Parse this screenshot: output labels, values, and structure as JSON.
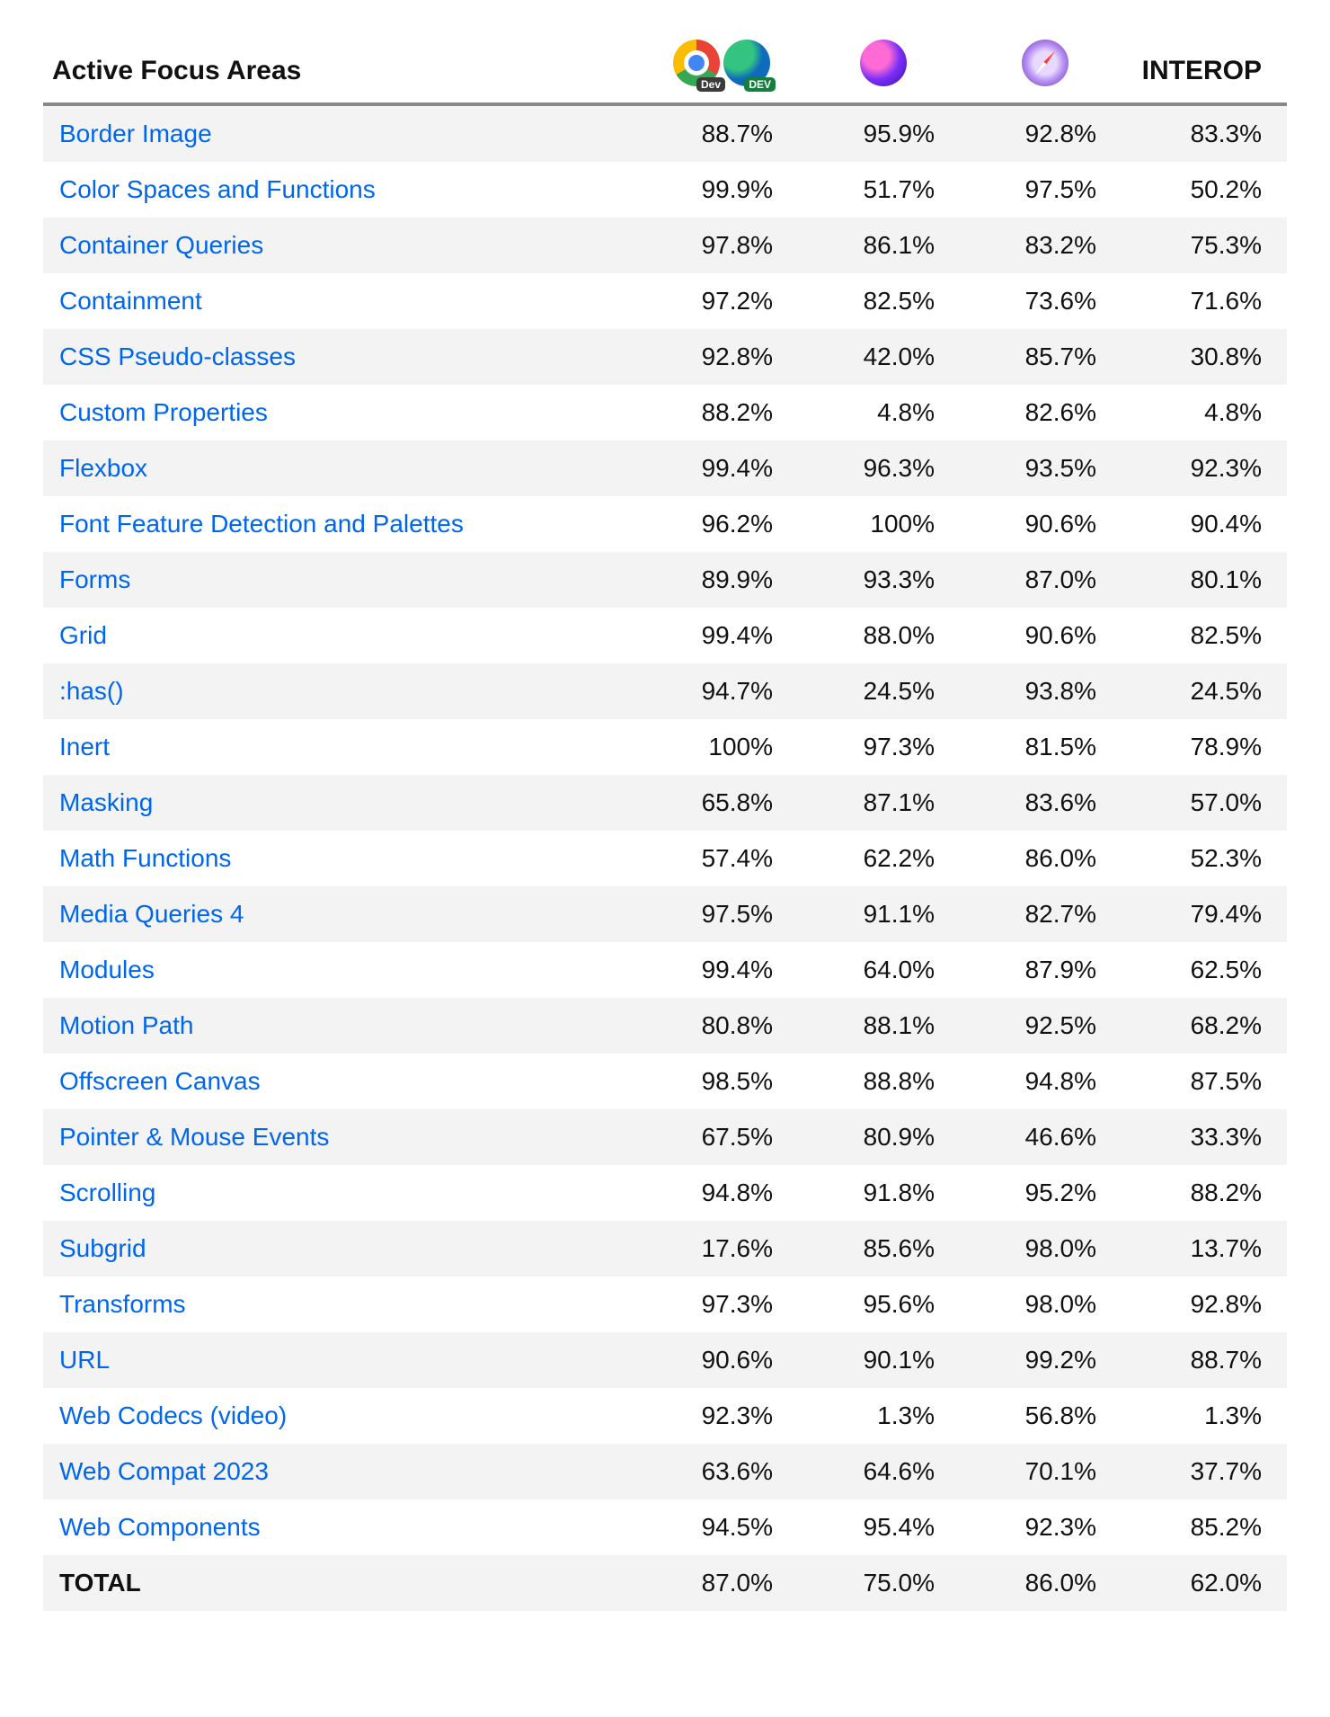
{
  "table": {
    "header": {
      "title": "Active Focus Areas",
      "interop_label": "INTEROP"
    },
    "browsers": {
      "chrome_badge": "Dev",
      "edge_badge": "DEV"
    },
    "rows": [
      {
        "name": "Border Image",
        "chrome_edge": "88.7%",
        "firefox": "95.9%",
        "safari": "92.8%",
        "interop": "83.3%"
      },
      {
        "name": "Color Spaces and Functions",
        "chrome_edge": "99.9%",
        "firefox": "51.7%",
        "safari": "97.5%",
        "interop": "50.2%"
      },
      {
        "name": "Container Queries",
        "chrome_edge": "97.8%",
        "firefox": "86.1%",
        "safari": "83.2%",
        "interop": "75.3%"
      },
      {
        "name": "Containment",
        "chrome_edge": "97.2%",
        "firefox": "82.5%",
        "safari": "73.6%",
        "interop": "71.6%"
      },
      {
        "name": "CSS Pseudo-classes",
        "chrome_edge": "92.8%",
        "firefox": "42.0%",
        "safari": "85.7%",
        "interop": "30.8%"
      },
      {
        "name": "Custom Properties",
        "chrome_edge": "88.2%",
        "firefox": "4.8%",
        "safari": "82.6%",
        "interop": "4.8%"
      },
      {
        "name": "Flexbox",
        "chrome_edge": "99.4%",
        "firefox": "96.3%",
        "safari": "93.5%",
        "interop": "92.3%"
      },
      {
        "name": "Font Feature Detection and Palettes",
        "chrome_edge": "96.2%",
        "firefox": "100%",
        "safari": "90.6%",
        "interop": "90.4%"
      },
      {
        "name": "Forms",
        "chrome_edge": "89.9%",
        "firefox": "93.3%",
        "safari": "87.0%",
        "interop": "80.1%"
      },
      {
        "name": "Grid",
        "chrome_edge": "99.4%",
        "firefox": "88.0%",
        "safari": "90.6%",
        "interop": "82.5%"
      },
      {
        "name": ":has()",
        "chrome_edge": "94.7%",
        "firefox": "24.5%",
        "safari": "93.8%",
        "interop": "24.5%"
      },
      {
        "name": "Inert",
        "chrome_edge": "100%",
        "firefox": "97.3%",
        "safari": "81.5%",
        "interop": "78.9%"
      },
      {
        "name": "Masking",
        "chrome_edge": "65.8%",
        "firefox": "87.1%",
        "safari": "83.6%",
        "interop": "57.0%"
      },
      {
        "name": "Math Functions",
        "chrome_edge": "57.4%",
        "firefox": "62.2%",
        "safari": "86.0%",
        "interop": "52.3%"
      },
      {
        "name": "Media Queries 4",
        "chrome_edge": "97.5%",
        "firefox": "91.1%",
        "safari": "82.7%",
        "interop": "79.4%"
      },
      {
        "name": "Modules",
        "chrome_edge": "99.4%",
        "firefox": "64.0%",
        "safari": "87.9%",
        "interop": "62.5%"
      },
      {
        "name": "Motion Path",
        "chrome_edge": "80.8%",
        "firefox": "88.1%",
        "safari": "92.5%",
        "interop": "68.2%"
      },
      {
        "name": "Offscreen Canvas",
        "chrome_edge": "98.5%",
        "firefox": "88.8%",
        "safari": "94.8%",
        "interop": "87.5%"
      },
      {
        "name": "Pointer & Mouse Events",
        "chrome_edge": "67.5%",
        "firefox": "80.9%",
        "safari": "46.6%",
        "interop": "33.3%"
      },
      {
        "name": "Scrolling",
        "chrome_edge": "94.8%",
        "firefox": "91.8%",
        "safari": "95.2%",
        "interop": "88.2%"
      },
      {
        "name": "Subgrid",
        "chrome_edge": "17.6%",
        "firefox": "85.6%",
        "safari": "98.0%",
        "interop": "13.7%"
      },
      {
        "name": "Transforms",
        "chrome_edge": "97.3%",
        "firefox": "95.6%",
        "safari": "98.0%",
        "interop": "92.8%"
      },
      {
        "name": "URL",
        "chrome_edge": "90.6%",
        "firefox": "90.1%",
        "safari": "99.2%",
        "interop": "88.7%"
      },
      {
        "name": "Web Codecs (video)",
        "chrome_edge": "92.3%",
        "firefox": "1.3%",
        "safari": "56.8%",
        "interop": "1.3%"
      },
      {
        "name": "Web Compat 2023",
        "chrome_edge": "63.6%",
        "firefox": "64.6%",
        "safari": "70.1%",
        "interop": "37.7%"
      },
      {
        "name": "Web Components",
        "chrome_edge": "94.5%",
        "firefox": "95.4%",
        "safari": "92.3%",
        "interop": "85.2%"
      }
    ],
    "total": {
      "label": "TOTAL",
      "chrome_edge": "87.0%",
      "firefox": "75.0%",
      "safari": "86.0%",
      "interop": "62.0%"
    }
  }
}
